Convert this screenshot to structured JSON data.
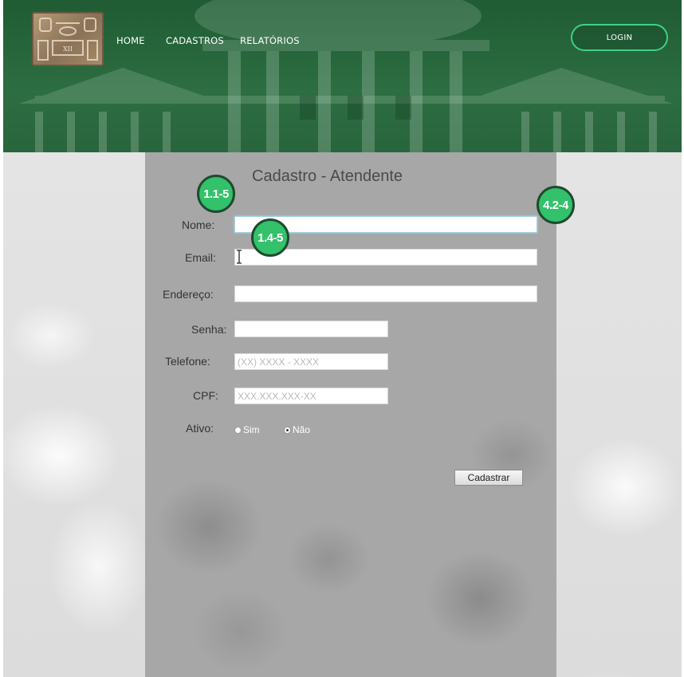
{
  "nav": {
    "home": "HOME",
    "cadastros": "CADASTROS",
    "relatorios": "RELATÓRIOS",
    "login": "LOGIN"
  },
  "logo": {
    "text": "XII"
  },
  "form": {
    "title": "Cadastro - Atendente",
    "nome_label": "Nome:",
    "email_label": "Email:",
    "endereco_label": "Endereço:",
    "senha_label": "Senha:",
    "telefone_label": "Telefone:",
    "telefone_placeholder": "(XX) XXXX - XXXX",
    "cpf_label": "CPF:",
    "cpf_placeholder": "XXX.XXX.XXX-XX",
    "ativo_label": "Ativo:",
    "ativo_options": [
      "Sim",
      "Não"
    ],
    "ativo_selected": "Não",
    "submit_label": "Cadastrar"
  },
  "badges": [
    "1.1-5",
    "1.4-5",
    "4.2-4"
  ],
  "colors": {
    "header_green": "#2d6b45",
    "login_border": "#3fd08a",
    "badge_green": "#33c16b",
    "panel_gray": "#a7a7a7"
  }
}
